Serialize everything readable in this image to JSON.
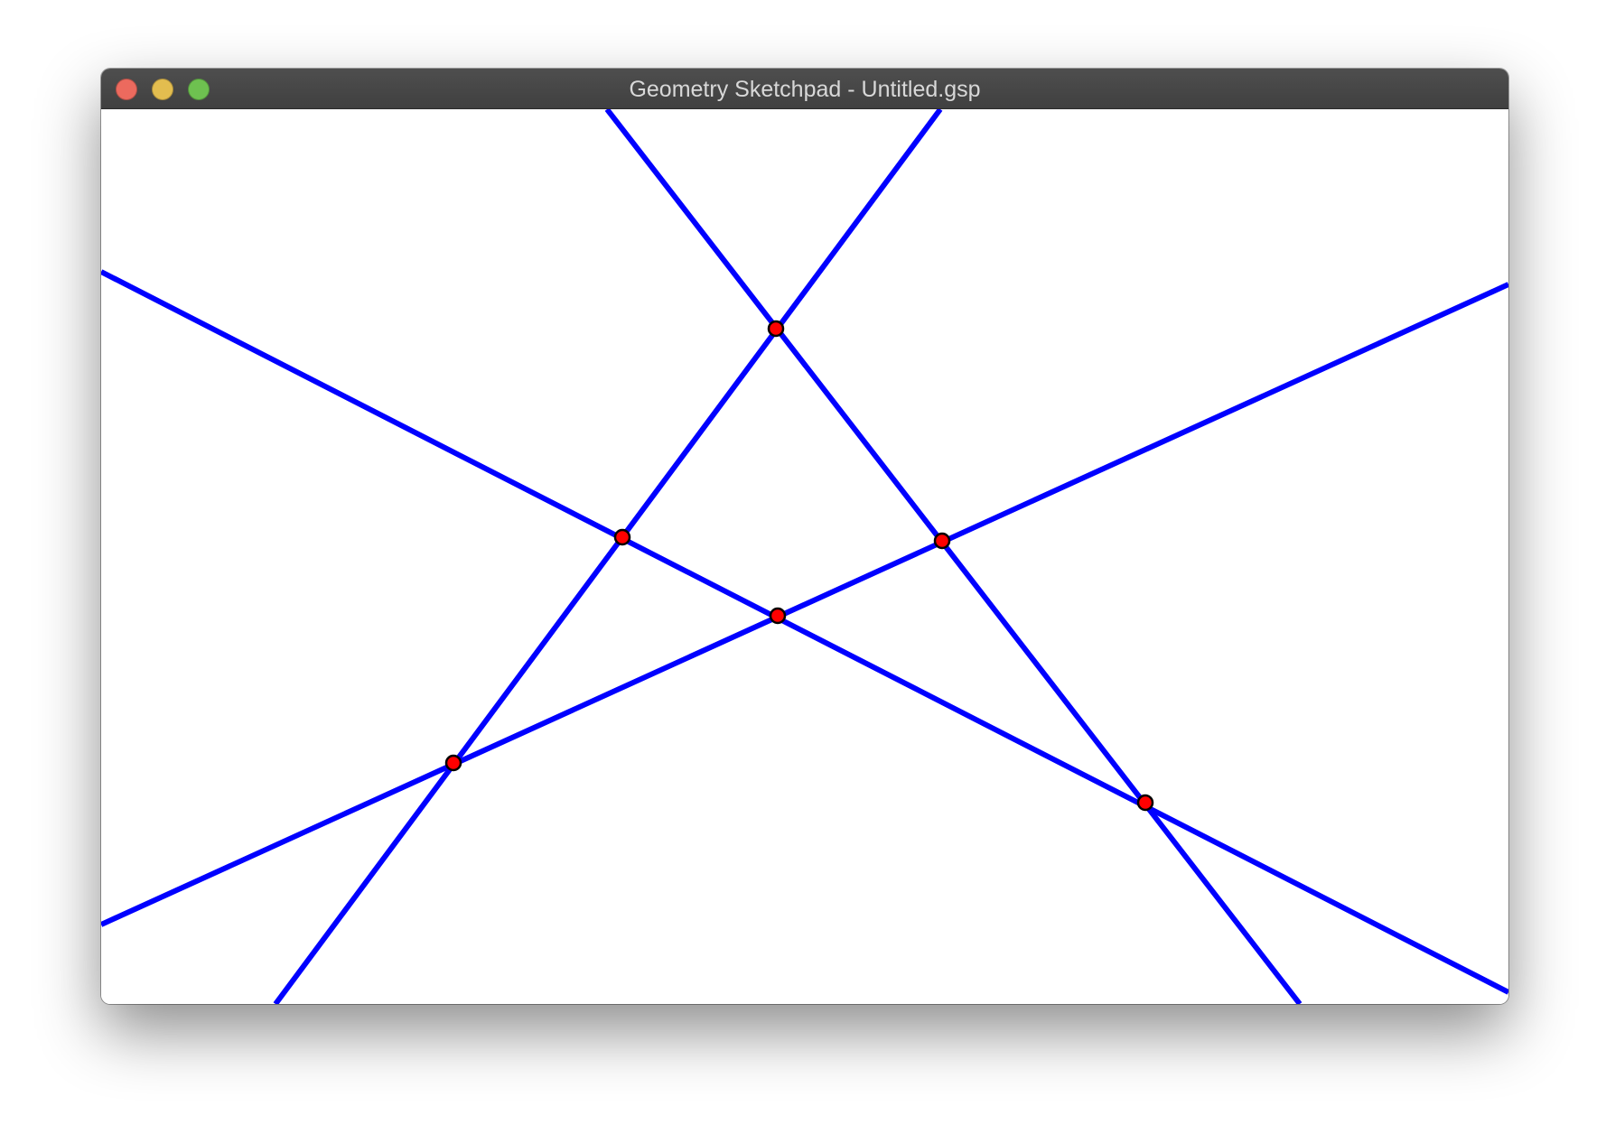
{
  "window": {
    "title": "Geometry Sketchpad - Untitled.gsp",
    "controls": {
      "close_color": "#ec6a5e",
      "minimize_color": "#e3bd4f",
      "maximize_color": "#6ec150"
    }
  },
  "sketch": {
    "line_color": "#0000ff",
    "point_fill": "#ff0000",
    "point_stroke": "#000000",
    "background": "#ffffff"
  }
}
